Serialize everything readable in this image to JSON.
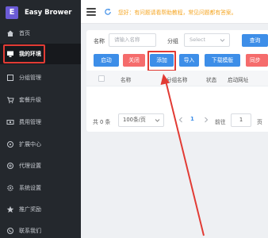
{
  "brand": {
    "logo_letter": "E",
    "name": "Easy Brower"
  },
  "sidebar": {
    "items": [
      {
        "label": "首页",
        "icon": "home-icon",
        "active": false
      },
      {
        "label": "我的环境",
        "icon": "monitor-icon",
        "active": true
      },
      {
        "label": "分组管理",
        "icon": "folder-icon",
        "active": false
      },
      {
        "label": "套餐升级",
        "icon": "cart-icon",
        "active": false
      },
      {
        "label": "费用管理",
        "icon": "money-icon",
        "active": false
      },
      {
        "label": "扩展中心",
        "icon": "extension-icon",
        "active": false
      },
      {
        "label": "代理设置",
        "icon": "proxy-icon",
        "active": false
      },
      {
        "label": "系统设置",
        "icon": "gear-icon",
        "active": false
      },
      {
        "label": "推广奖励",
        "icon": "star-icon",
        "active": false
      },
      {
        "label": "联系我们",
        "icon": "phone-icon",
        "active": false
      }
    ]
  },
  "topbar": {
    "notice": "您好：有问题请看帮助教程，常见问题都有答案。"
  },
  "filters": {
    "name_label": "名称",
    "name_placeholder": "请输入名称",
    "group_label": "分组",
    "group_placeholder": "Select",
    "search_label": "查询"
  },
  "toolbar": {
    "start_label": "启动",
    "close_label": "关闭",
    "add_label": "添加",
    "import_label": "导入",
    "download_template_label": "下载模版",
    "sync_label": "同步"
  },
  "table": {
    "columns": [
      "名称",
      "分组名称",
      "状态",
      "启动网址"
    ]
  },
  "pagination": {
    "total": "共 0 条",
    "page_size": "100条/页",
    "current_page": "1",
    "goto_label": "前往",
    "goto_value": "1",
    "page_suffix": "页"
  },
  "colors": {
    "sidebar_bg": "#24282d",
    "primary": "#3d8ee8",
    "danger": "#f56c6c",
    "highlight": "#e23b34",
    "notice": "#f5a623"
  }
}
